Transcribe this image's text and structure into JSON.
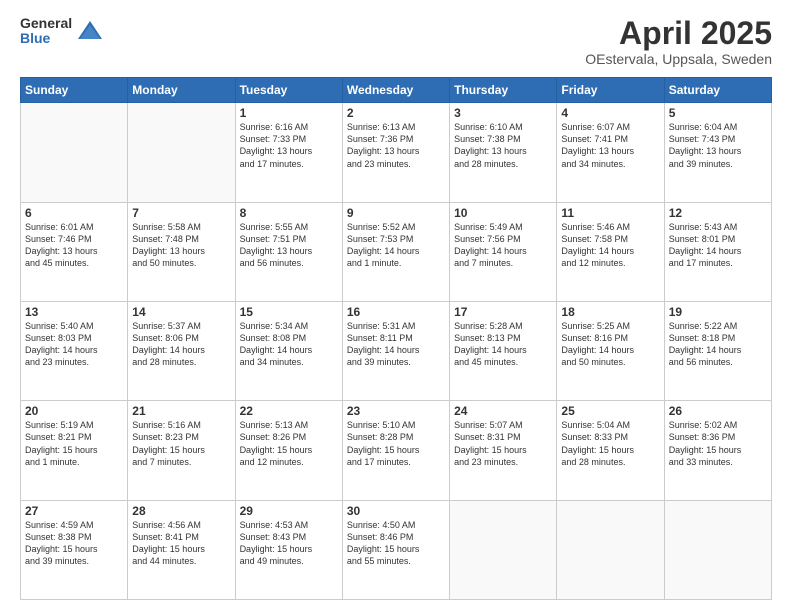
{
  "logo": {
    "general": "General",
    "blue": "Blue"
  },
  "header": {
    "title": "April 2025",
    "subtitle": "OEstervala, Uppsala, Sweden"
  },
  "days_of_week": [
    "Sunday",
    "Monday",
    "Tuesday",
    "Wednesday",
    "Thursday",
    "Friday",
    "Saturday"
  ],
  "weeks": [
    [
      {
        "day": "",
        "info": ""
      },
      {
        "day": "",
        "info": ""
      },
      {
        "day": "1",
        "info": "Sunrise: 6:16 AM\nSunset: 7:33 PM\nDaylight: 13 hours\nand 17 minutes."
      },
      {
        "day": "2",
        "info": "Sunrise: 6:13 AM\nSunset: 7:36 PM\nDaylight: 13 hours\nand 23 minutes."
      },
      {
        "day": "3",
        "info": "Sunrise: 6:10 AM\nSunset: 7:38 PM\nDaylight: 13 hours\nand 28 minutes."
      },
      {
        "day": "4",
        "info": "Sunrise: 6:07 AM\nSunset: 7:41 PM\nDaylight: 13 hours\nand 34 minutes."
      },
      {
        "day": "5",
        "info": "Sunrise: 6:04 AM\nSunset: 7:43 PM\nDaylight: 13 hours\nand 39 minutes."
      }
    ],
    [
      {
        "day": "6",
        "info": "Sunrise: 6:01 AM\nSunset: 7:46 PM\nDaylight: 13 hours\nand 45 minutes."
      },
      {
        "day": "7",
        "info": "Sunrise: 5:58 AM\nSunset: 7:48 PM\nDaylight: 13 hours\nand 50 minutes."
      },
      {
        "day": "8",
        "info": "Sunrise: 5:55 AM\nSunset: 7:51 PM\nDaylight: 13 hours\nand 56 minutes."
      },
      {
        "day": "9",
        "info": "Sunrise: 5:52 AM\nSunset: 7:53 PM\nDaylight: 14 hours\nand 1 minute."
      },
      {
        "day": "10",
        "info": "Sunrise: 5:49 AM\nSunset: 7:56 PM\nDaylight: 14 hours\nand 7 minutes."
      },
      {
        "day": "11",
        "info": "Sunrise: 5:46 AM\nSunset: 7:58 PM\nDaylight: 14 hours\nand 12 minutes."
      },
      {
        "day": "12",
        "info": "Sunrise: 5:43 AM\nSunset: 8:01 PM\nDaylight: 14 hours\nand 17 minutes."
      }
    ],
    [
      {
        "day": "13",
        "info": "Sunrise: 5:40 AM\nSunset: 8:03 PM\nDaylight: 14 hours\nand 23 minutes."
      },
      {
        "day": "14",
        "info": "Sunrise: 5:37 AM\nSunset: 8:06 PM\nDaylight: 14 hours\nand 28 minutes."
      },
      {
        "day": "15",
        "info": "Sunrise: 5:34 AM\nSunset: 8:08 PM\nDaylight: 14 hours\nand 34 minutes."
      },
      {
        "day": "16",
        "info": "Sunrise: 5:31 AM\nSunset: 8:11 PM\nDaylight: 14 hours\nand 39 minutes."
      },
      {
        "day": "17",
        "info": "Sunrise: 5:28 AM\nSunset: 8:13 PM\nDaylight: 14 hours\nand 45 minutes."
      },
      {
        "day": "18",
        "info": "Sunrise: 5:25 AM\nSunset: 8:16 PM\nDaylight: 14 hours\nand 50 minutes."
      },
      {
        "day": "19",
        "info": "Sunrise: 5:22 AM\nSunset: 8:18 PM\nDaylight: 14 hours\nand 56 minutes."
      }
    ],
    [
      {
        "day": "20",
        "info": "Sunrise: 5:19 AM\nSunset: 8:21 PM\nDaylight: 15 hours\nand 1 minute."
      },
      {
        "day": "21",
        "info": "Sunrise: 5:16 AM\nSunset: 8:23 PM\nDaylight: 15 hours\nand 7 minutes."
      },
      {
        "day": "22",
        "info": "Sunrise: 5:13 AM\nSunset: 8:26 PM\nDaylight: 15 hours\nand 12 minutes."
      },
      {
        "day": "23",
        "info": "Sunrise: 5:10 AM\nSunset: 8:28 PM\nDaylight: 15 hours\nand 17 minutes."
      },
      {
        "day": "24",
        "info": "Sunrise: 5:07 AM\nSunset: 8:31 PM\nDaylight: 15 hours\nand 23 minutes."
      },
      {
        "day": "25",
        "info": "Sunrise: 5:04 AM\nSunset: 8:33 PM\nDaylight: 15 hours\nand 28 minutes."
      },
      {
        "day": "26",
        "info": "Sunrise: 5:02 AM\nSunset: 8:36 PM\nDaylight: 15 hours\nand 33 minutes."
      }
    ],
    [
      {
        "day": "27",
        "info": "Sunrise: 4:59 AM\nSunset: 8:38 PM\nDaylight: 15 hours\nand 39 minutes."
      },
      {
        "day": "28",
        "info": "Sunrise: 4:56 AM\nSunset: 8:41 PM\nDaylight: 15 hours\nand 44 minutes."
      },
      {
        "day": "29",
        "info": "Sunrise: 4:53 AM\nSunset: 8:43 PM\nDaylight: 15 hours\nand 49 minutes."
      },
      {
        "day": "30",
        "info": "Sunrise: 4:50 AM\nSunset: 8:46 PM\nDaylight: 15 hours\nand 55 minutes."
      },
      {
        "day": "",
        "info": ""
      },
      {
        "day": "",
        "info": ""
      },
      {
        "day": "",
        "info": ""
      }
    ]
  ]
}
